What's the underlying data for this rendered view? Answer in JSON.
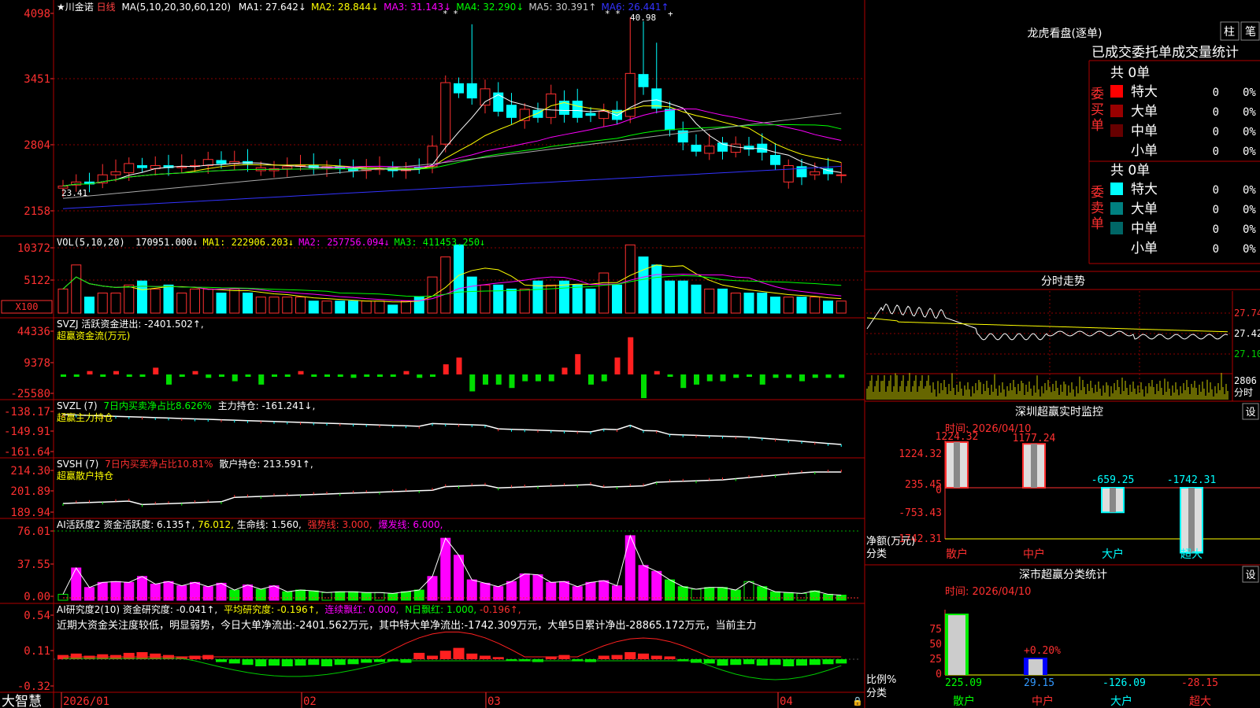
{
  "stock": {
    "name": "★川金诺",
    "period": "日线"
  },
  "main": {
    "ma_header": "MA(5,10,20,30,60,120)",
    "ma_items": [
      {
        "text": "MA1: 27.642↓",
        "color": "#ffffff"
      },
      {
        "text": "MA2: 28.844↓",
        "color": "#ffff00"
      },
      {
        "text": "MA3: 31.143↓",
        "color": "#ff00ff"
      },
      {
        "text": "MA4: 32.290↓",
        "color": "#00ff00"
      },
      {
        "text": "MA5: 30.391↑",
        "color": "#cccccc"
      },
      {
        "text": "MA6: 26.441↑",
        "color": "#3333ff"
      }
    ],
    "y_ticks": [
      "4098",
      "3451",
      "2804",
      "2158"
    ],
    "high_label": "40.98",
    "low_label": "23.41"
  },
  "vol": {
    "header": "VOL(5,10,20)",
    "items": [
      {
        "text": "170951.000↓",
        "color": "#ffffff"
      },
      {
        "text": "MA1: 222906.203↓",
        "color": "#ffff00"
      },
      {
        "text": "MA2: 257756.094↓",
        "color": "#ff00ff"
      },
      {
        "text": "MA3: 411453.250↓",
        "color": "#00ff00"
      }
    ],
    "y_ticks": [
      "10372",
      "5122"
    ],
    "unit": "X100"
  },
  "svzj": {
    "line1": "SVZJ  活跃资金进出: -2401.502↑,",
    "line2": "超赢资金流(万元)",
    "y_ticks": [
      "44336",
      "9378",
      "-25580"
    ]
  },
  "svzl": {
    "label": "SVZL (7)",
    "part2": "7日内买卖净占比8.626%",
    "part3": "主力持仓: -161.241↓,",
    "line2": "超赢主力持仓",
    "y_ticks": [
      "-138.17",
      "-149.91",
      "-161.64"
    ]
  },
  "svsh": {
    "label": "SVSH (7)",
    "part2": "7日内买卖净占比10.81%",
    "part3": "散户持仓: 213.591↑,",
    "line2": "超赢散户持仓",
    "y_ticks": [
      "214.30",
      "201.89",
      "189.94"
    ]
  },
  "ai1": {
    "p1": "AI活跃度2 资金活跃度: 6.135↑,",
    "p2": "76.012,",
    "p3": "生命线: 1.560,",
    "p4": "强势线: 3.000,",
    "p5": "爆发线: 6.000,",
    "y_ticks": [
      "76.01",
      "37.55",
      "0.00"
    ]
  },
  "ai2": {
    "p1": "AI研究度2(10) 资金研究度: -0.041↑,",
    "p2": "平均研究度: -0.196↑,",
    "p3": "连续飘红: 0.000,",
    "p4": "N日飘红: 1.000,",
    "p5": "-0.196↑,",
    "desc": "近期大资金关注度较低，明显弱势，今日大单净流出:-2401.562万元，其中特大单净流出:-1742.309万元，大单5日累计净出-28865.172万元，当前主力",
    "y_ticks": [
      "0.54",
      "0.11",
      "-0.32"
    ]
  },
  "xaxis": {
    "labels": [
      "2026/01",
      "02",
      "03",
      "04"
    ],
    "brand": "大智慧"
  },
  "lhb": {
    "title": "龙虎看盘(逐单)",
    "btn1": "柱",
    "btn2": "笔",
    "subtitle": "已成交委托单成交量统计",
    "buy_label": [
      "委",
      "买",
      "单"
    ],
    "sell_label": [
      "委",
      "卖",
      "单"
    ],
    "buy_total": "共 0单",
    "sell_total": "共 0单",
    "buy_rows": [
      {
        "name": "特大",
        "val": "0",
        "pct": "0%",
        "color": "#ff0000"
      },
      {
        "name": "大单",
        "val": "0",
        "pct": "0%",
        "color": "#990000"
      },
      {
        "name": "中单",
        "val": "0",
        "pct": "0%",
        "color": "#660000"
      },
      {
        "name": "小单",
        "val": "0",
        "pct": "0%",
        "color": ""
      }
    ],
    "sell_rows": [
      {
        "name": "特大",
        "val": "0",
        "pct": "0%",
        "color": "#00ffff"
      },
      {
        "name": "大单",
        "val": "0",
        "pct": "0%",
        "color": "#008080"
      },
      {
        "name": "中单",
        "val": "0",
        "pct": "0%",
        "color": "#006666"
      },
      {
        "name": "小单",
        "val": "0",
        "pct": "0%",
        "color": ""
      }
    ]
  },
  "intraday": {
    "title": "分时走势",
    "y_ticks": [
      "27.74",
      "27.42",
      "27.10"
    ],
    "vol_tick": "2806",
    "vol_unit": "分时"
  },
  "monitor": {
    "title": "深圳超赢实时监控",
    "settings": "设",
    "time": "时间: 2026/04/10",
    "y_ticks": [
      "1224.32",
      "235.45",
      "0",
      "-753.43",
      "-1742.31"
    ],
    "y_label": "净额(万元)",
    "x_label": "分类",
    "categories": [
      "散户",
      "中户",
      "大户",
      "超大"
    ],
    "values": [
      1224.32,
      1177.24,
      -659.25,
      -1742.31
    ],
    "value_labels": [
      "1224.32",
      "1177.24",
      "-659.25",
      "-1742.31"
    ]
  },
  "classify": {
    "title": "深市超赢分类统计",
    "settings": "设",
    "time": "时间: 2026/04/10",
    "y_ticks": [
      "75",
      "50",
      "25",
      "0"
    ],
    "y_label": "比例%",
    "x_label": "分类",
    "categories": [
      "散户",
      "中户",
      "大户",
      "超大"
    ],
    "pct_label": "+0.20%",
    "values": [
      "225.09",
      "29.15",
      "-126.09",
      "-28.15"
    ]
  }
}
